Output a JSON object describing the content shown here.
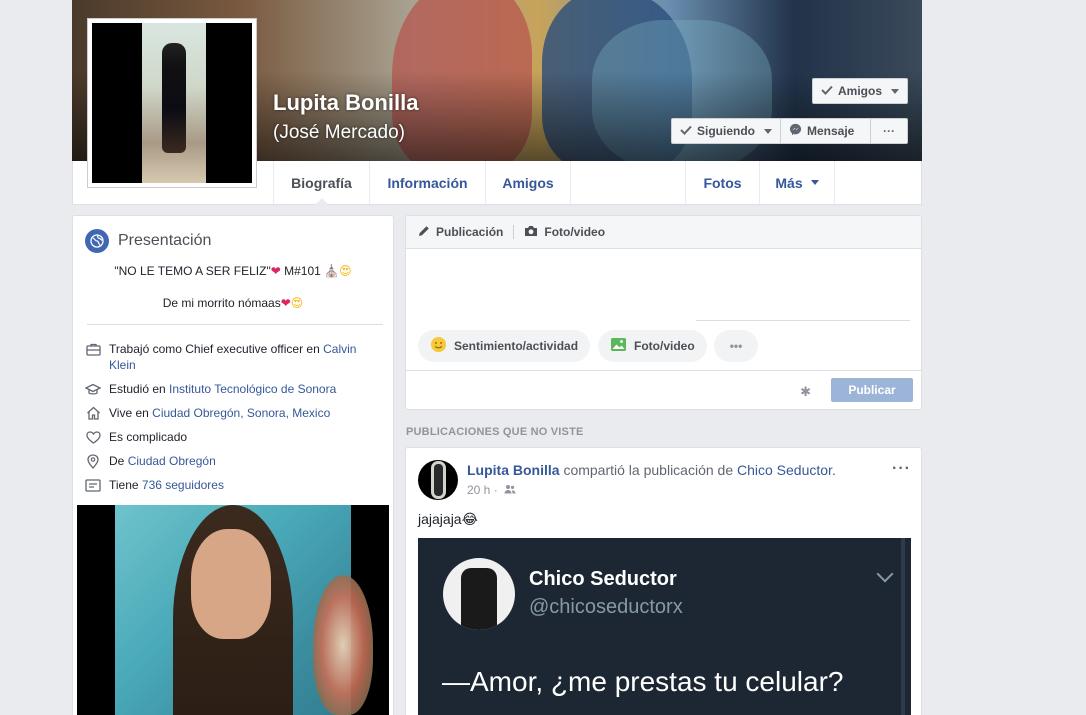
{
  "profile": {
    "name": "Lupita Bonilla",
    "alternate_name": "(José Mercado)"
  },
  "cover_buttons": {
    "friends": "Amigos",
    "following": "Siguiendo",
    "message": "Mensaje",
    "more": "···"
  },
  "tabs": [
    {
      "label": "Biografía",
      "active": true
    },
    {
      "label": "Información"
    },
    {
      "label": "Amigos"
    },
    {
      "label": "Fotos"
    },
    {
      "label": "Más"
    }
  ],
  "intro": {
    "title": "Presentación",
    "bio_line1": "\"NO LE TEMO A SER FELIZ\"",
    "bio_line1_tail": " M#101",
    "bio_line2": "De mi morrito nómaas",
    "items": [
      {
        "icon": "briefcase-icon",
        "prefix": "Trabajó como Chief executive officer en ",
        "link": "Calvin Klein"
      },
      {
        "icon": "graduation-cap-icon",
        "prefix": "Estudió en ",
        "link": "Instituto Tecnológico de Sonora"
      },
      {
        "icon": "home-icon",
        "prefix": "Vive en ",
        "link": "Ciudad Obregón, Sonora, Mexico"
      },
      {
        "icon": "heart-icon",
        "prefix": "Es complicado",
        "link": ""
      },
      {
        "icon": "location-pin-icon",
        "prefix": "De ",
        "link": "Ciudad Obregón"
      },
      {
        "icon": "followers-icon",
        "prefix": "Tiene ",
        "link": "736 seguidores"
      }
    ]
  },
  "composer": {
    "tab_post": "Publicación",
    "tab_photo": "Foto/video",
    "feeling": "Sentimiento/actividad",
    "photo": "Foto/video",
    "more": "•••",
    "publish": "Publicar"
  },
  "section_label": "PUBLICACIONES QUE NO VISTE",
  "post": {
    "author": "Lupita Bonilla",
    "action": " compartió la publicación de ",
    "shared_from": "Chico Seductor.",
    "time": "20 h ·",
    "text": "jajajaja😂",
    "shared_card": {
      "name": "Chico Seductor",
      "handle": "@chicoseductorx",
      "quote": "—Amor, ¿me prestas tu celular?"
    }
  },
  "colors": {
    "link": "#365899",
    "facebook_blue": "#4267b2",
    "background": "#e9ebee"
  }
}
